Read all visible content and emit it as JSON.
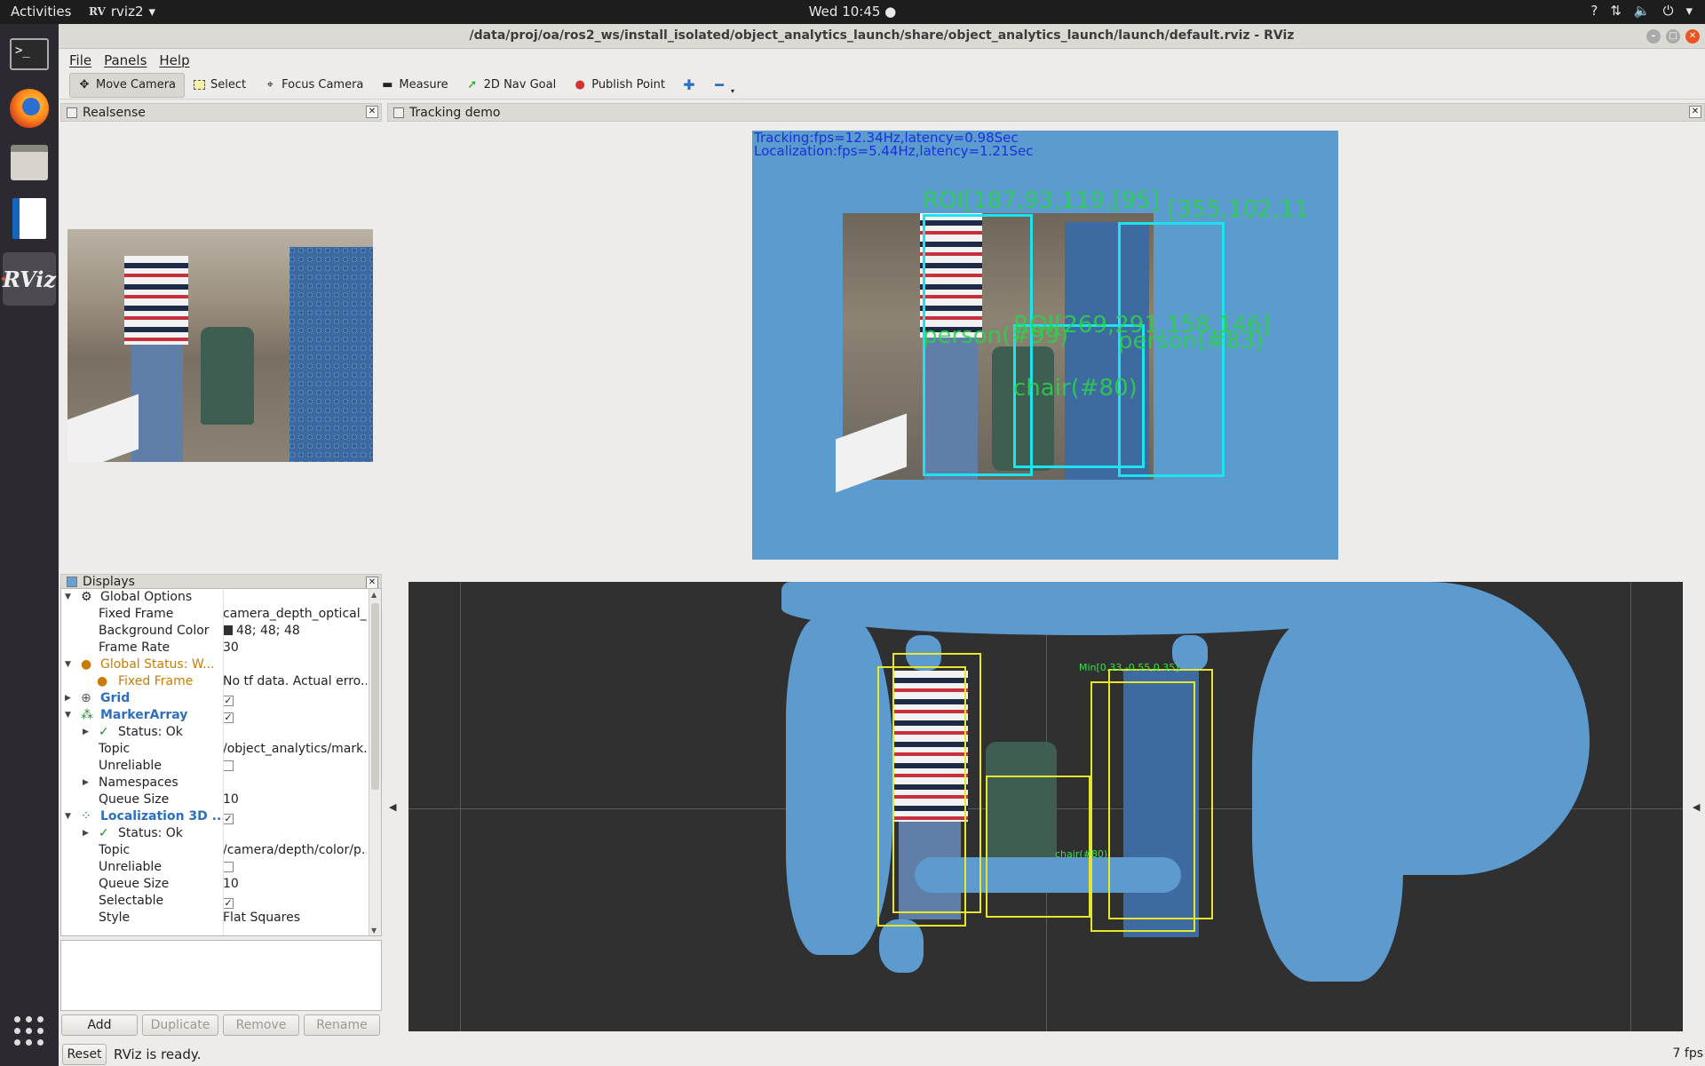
{
  "topbar": {
    "activities": "Activities",
    "app_name": "rviz2",
    "clock": "Wed 10:45 ●"
  },
  "window": {
    "title": "/data/proj/oa/ros2_ws/install_isolated/object_analytics_launch/share/object_analytics_launch/launch/default.rviz - RViz"
  },
  "menu": [
    "File",
    "Panels",
    "Help"
  ],
  "toolbar": {
    "move_camera": "Move Camera",
    "select": "Select",
    "focus_camera": "Focus Camera",
    "measure": "Measure",
    "nav_goal": "2D Nav Goal",
    "publish_point": "Publish Point"
  },
  "panels": {
    "realsense": "Realsense",
    "tracking": "Tracking demo",
    "displays": "Displays"
  },
  "tracking_overlay": {
    "line1": "Tracking:fps=12.34Hz,latency=0.98Sec",
    "line2": "Localization:fps=5.44Hz,latency=1.21Sec",
    "roi1": "ROI[187,93,119,[95]",
    "roi2": "[355,102,11",
    "roi3": "ROI[269,291,158,146]",
    "person1": "person(#99)",
    "person2": "person(#83)",
    "chair": "chair(#80)"
  },
  "displays_tree": {
    "global_options": "Global Options",
    "fixed_frame_k": "Fixed Frame",
    "fixed_frame_v": "camera_depth_optical_...",
    "bg_color_k": "Background Color",
    "bg_color_v": "48; 48; 48",
    "frame_rate_k": "Frame Rate",
    "frame_rate_v": "30",
    "global_status": "Global Status: W...",
    "gs_fixed_frame_k": "Fixed Frame",
    "gs_fixed_frame_v": "No tf data.  Actual erro...",
    "grid": "Grid",
    "marker_array": "MarkerArray",
    "ma_status": "Status: Ok",
    "ma_topic_k": "Topic",
    "ma_topic_v": "/object_analytics/mark...",
    "ma_unreliable_k": "Unreliable",
    "ma_namespaces": "Namespaces",
    "ma_queue_k": "Queue Size",
    "ma_queue_v": "10",
    "loc3d": "Localization 3D ...",
    "loc_status": "Status: Ok",
    "loc_topic_k": "Topic",
    "loc_topic_v": "/camera/depth/color/p...",
    "loc_unreliable_k": "Unreliable",
    "loc_queue_k": "Queue Size",
    "loc_queue_v": "10",
    "loc_selectable_k": "Selectable",
    "loc_style_k": "Style",
    "loc_style_v": "Flat Squares"
  },
  "display_buttons": {
    "add": "Add",
    "duplicate": "Duplicate",
    "remove": "Remove",
    "rename": "Rename"
  },
  "view3d_labels": {
    "min1": "Min[0.33,-0.55,0.35]",
    "chair": "chair(#80)"
  },
  "status": {
    "reset": "Reset",
    "message": "RViz is ready.",
    "fps": "7 fps"
  },
  "colors": {
    "accent": "#e95420",
    "tracking_text": "#1b2fe0",
    "box": "#1de3ee",
    "label_green": "#2bd34a",
    "bbox3d": "#e6e62a",
    "viewport_bg": "#303030",
    "cloud": "#5d9acd"
  },
  "icons": [
    "terminal-icon",
    "firefox-icon",
    "files-icon",
    "writer-icon",
    "rviz-icon",
    "apps-grid-icon"
  ]
}
